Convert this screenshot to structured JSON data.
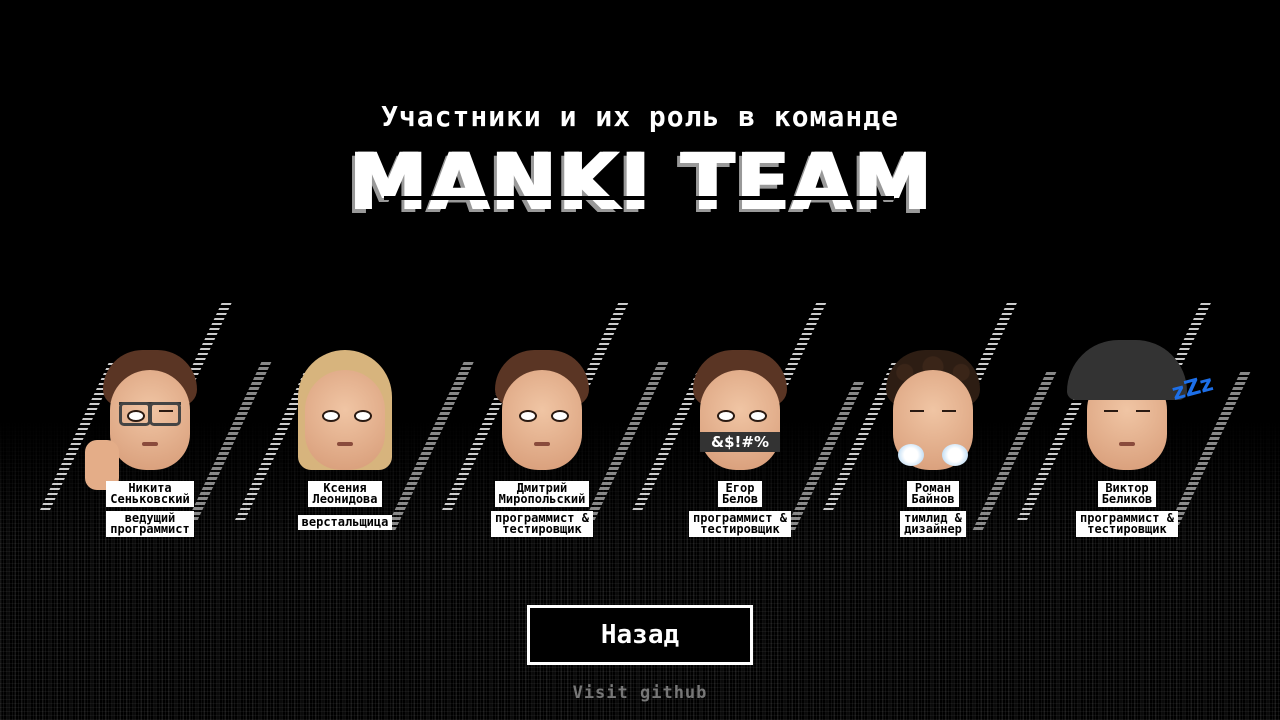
{
  "header": {
    "subtitle": "Участники и их роль в команде",
    "title": "MANKI TEAM"
  },
  "members": [
    {
      "name": "Никита\nСеньковский",
      "role": "ведущий\nпрограммист",
      "avatar": "memoji-glasses-thumbs-down"
    },
    {
      "name": "Ксения\nЛеонидова",
      "role": "верстальщица",
      "avatar": "memoji-blonde-frowning"
    },
    {
      "name": "Дмитрий\nМиропольский",
      "role": "программист &\nтестировщик",
      "avatar": "memoji-teary-eyes"
    },
    {
      "name": "Егор\nБелов",
      "role": "программист &\nтестировщик",
      "avatar": "memoji-censored-mouth",
      "censor_text": "&$!#%"
    },
    {
      "name": "Роман\nБайнов",
      "role": "тимлид &\nдизайнер",
      "avatar": "memoji-steam-nose"
    },
    {
      "name": "Виктор\nБеликов",
      "role": "программист &\nтестировщик",
      "avatar": "memoji-sleeping-hat",
      "zzz_text": "zZz"
    }
  ],
  "back_button": {
    "label": "Назад"
  },
  "github_link": {
    "label": "Visit github"
  }
}
